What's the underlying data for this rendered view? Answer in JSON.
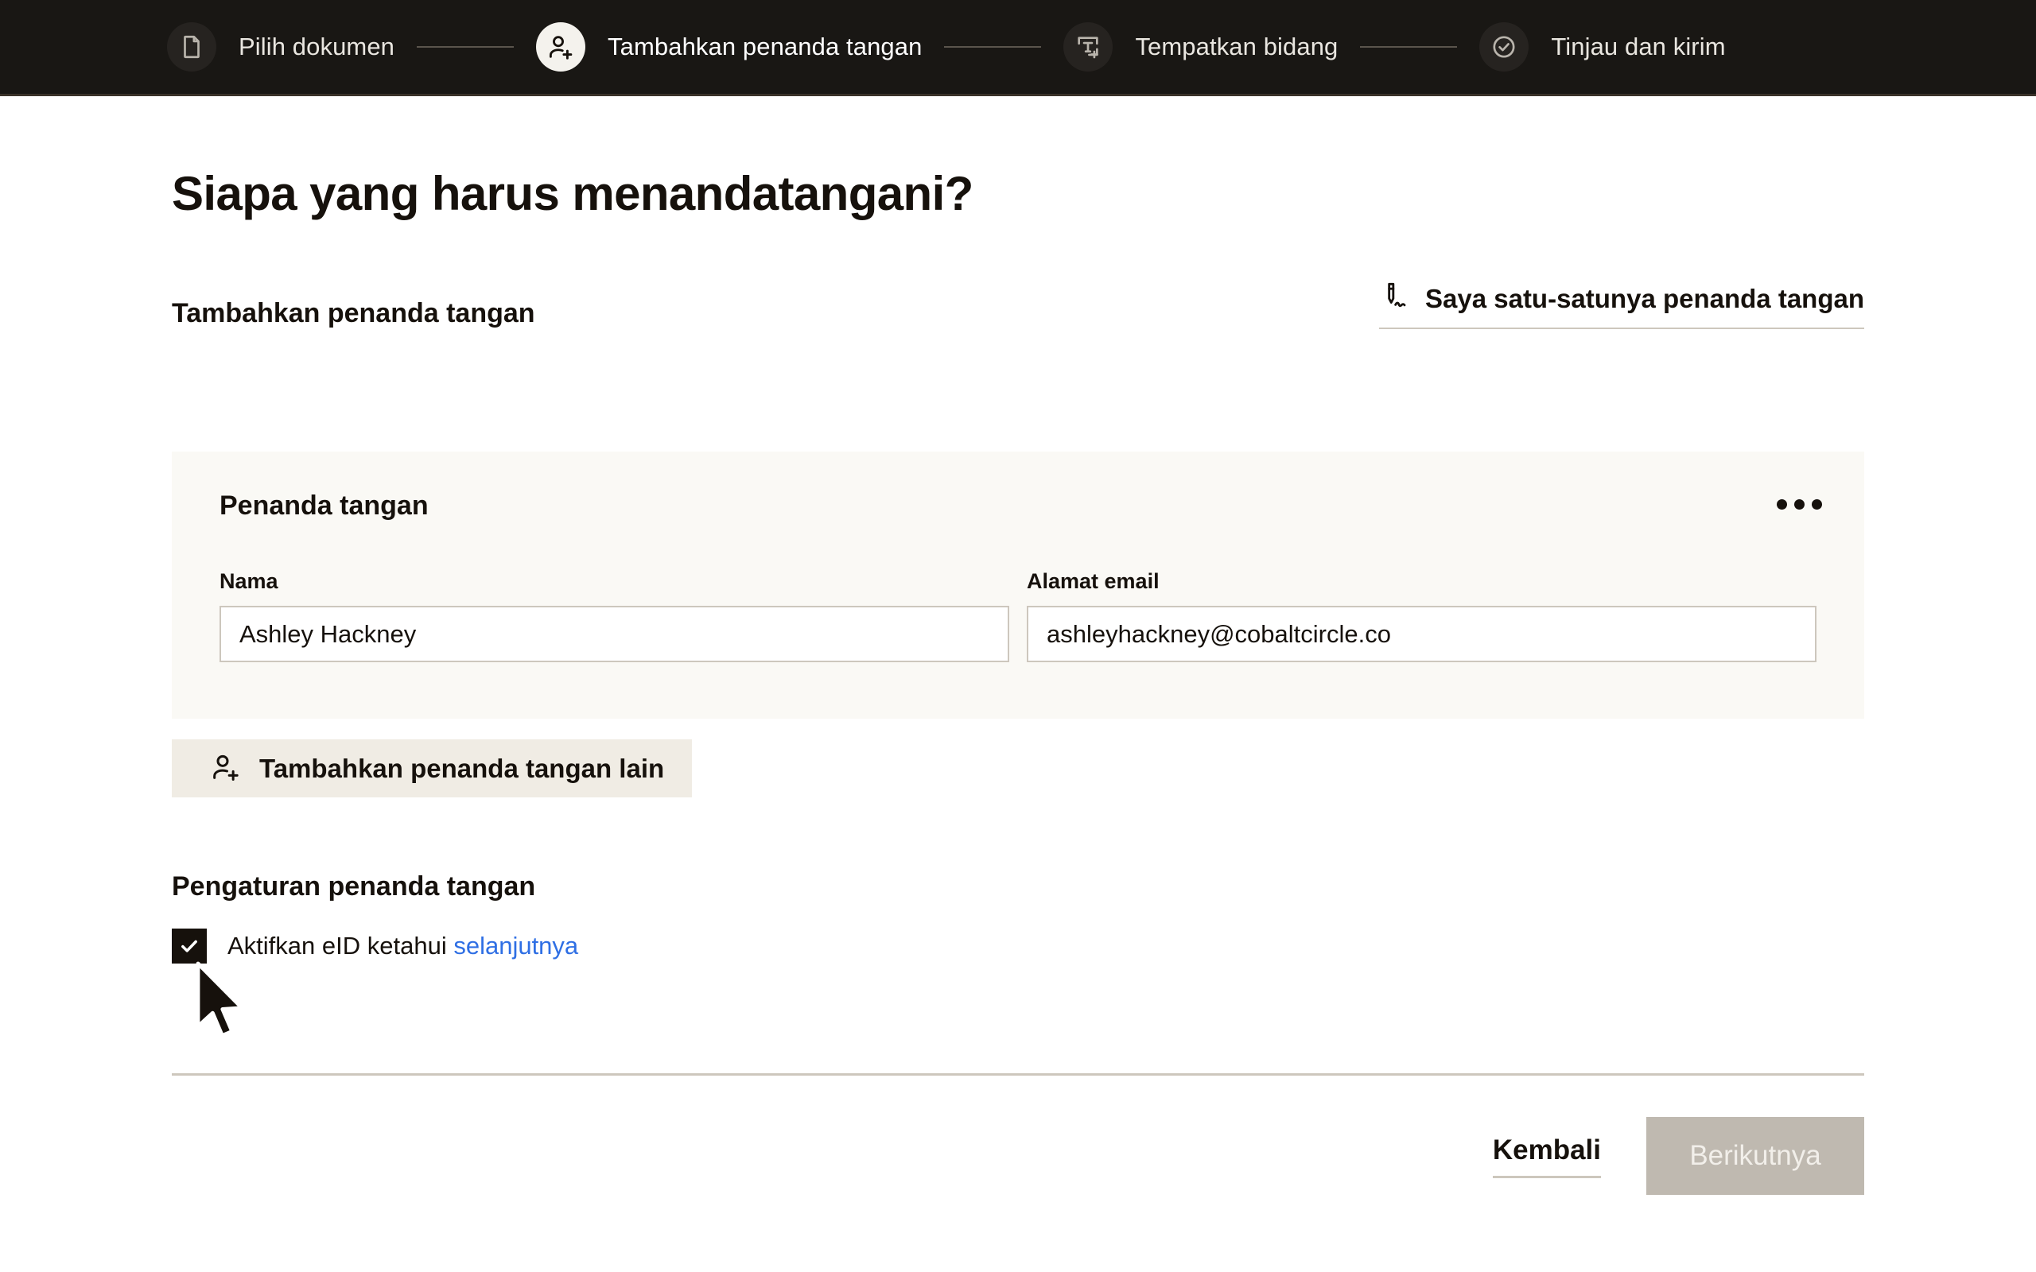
{
  "stepper": {
    "steps": [
      {
        "label": "Pilih dokumen",
        "icon": "document-icon",
        "active": false
      },
      {
        "label": "Tambahkan penanda tangan",
        "icon": "person-add-icon",
        "active": true
      },
      {
        "label": "Tempatkan bidang",
        "icon": "text-field-icon",
        "active": false
      },
      {
        "label": "Tinjau dan kirim",
        "icon": "check-circle-icon",
        "active": false
      }
    ]
  },
  "main": {
    "title": "Siapa yang harus menandatangani?",
    "section_heading": "Tambahkan penanda tangan",
    "sole_signer_label": "Saya satu-satunya penanda tangan",
    "sole_signer_icon": "signature-pen-icon"
  },
  "signer_card": {
    "title": "Penanda tangan",
    "menu_icon": "overflow-menu-icon",
    "name_label": "Nama",
    "name_value": "Ashley Hackney",
    "name_placeholder": "Nama",
    "email_label": "Alamat email",
    "email_value": "ashleyhackney@cobaltcircle.co",
    "email_placeholder": "Alamat email"
  },
  "add_signer": {
    "label": "Tambahkan penanda tangan lain",
    "icon": "person-add-icon"
  },
  "settings": {
    "heading": "Pengaturan penanda tangan",
    "checkbox_checked": true,
    "checkbox_text": "Aktifkan eID ketahui",
    "checkbox_link": "selanjutnya"
  },
  "footer": {
    "back_label": "Kembali",
    "next_label": "Berikutnya"
  },
  "colors": {
    "topbar_bg": "#191714",
    "card_bg": "#faf9f5",
    "button_bg": "#f0ece4",
    "link_blue": "#2f6fe4",
    "disabled_btn": "#bfb9b0",
    "border": "#cdc7bd",
    "text": "#16110c"
  }
}
